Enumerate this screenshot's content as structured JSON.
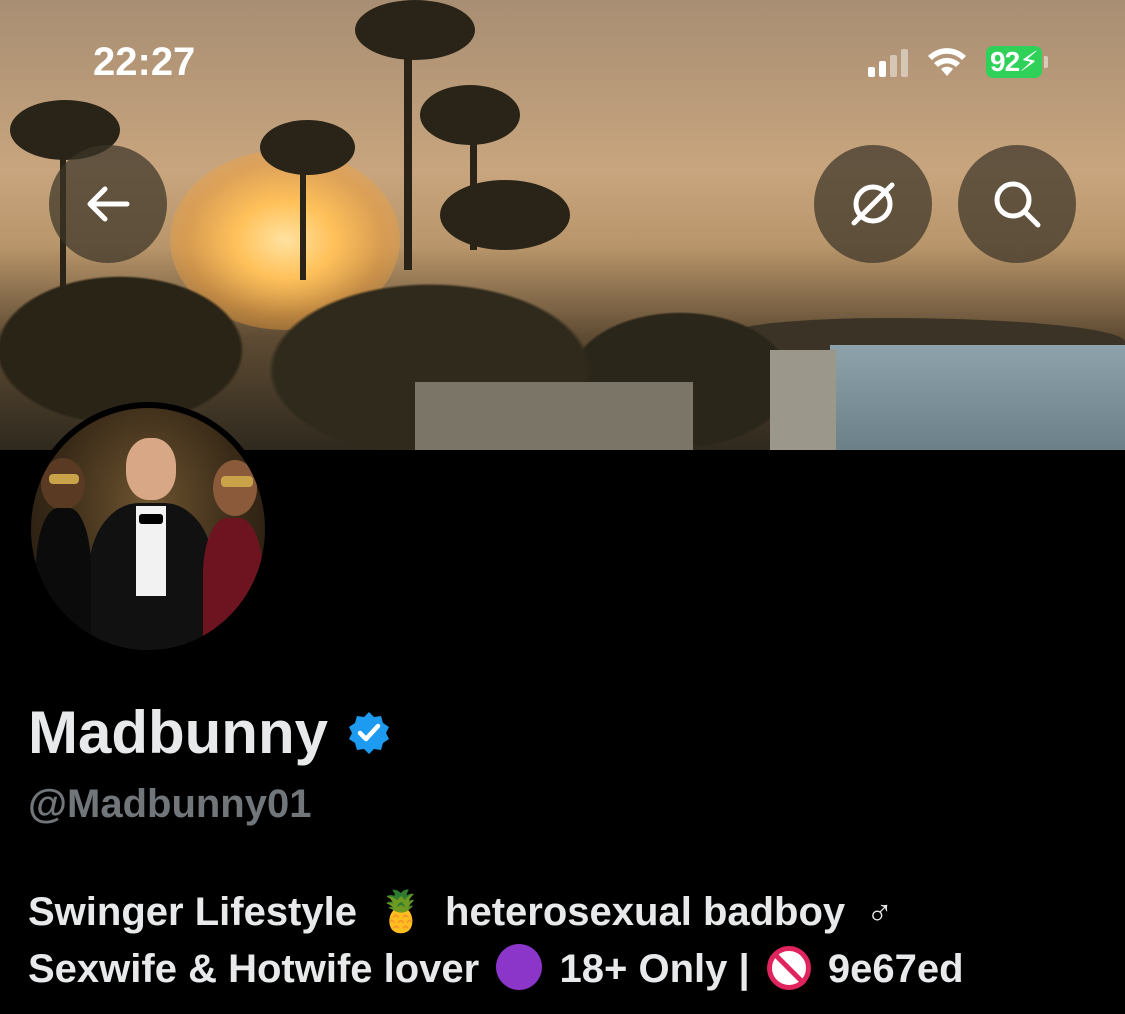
{
  "status_bar": {
    "time": "22:27",
    "battery": "92",
    "icons": [
      "cellular-signal-icon",
      "wifi-icon",
      "battery-charging-icon"
    ]
  },
  "header": {
    "back_icon": "arrow-left-icon",
    "grok_icon": "grok-icon",
    "search_icon": "search-icon"
  },
  "profile": {
    "display_name": "Madbunny",
    "verified": true,
    "verified_color": "#1d9bf0",
    "handle": "@Madbunny01",
    "bio_line1_a": "Swinger Lifestyle",
    "bio_line1_emoji1": "🍍",
    "bio_line1_b": "heterosexual badboy",
    "bio_line1_symbol": "♂",
    "bio_line2_a": "Sexwife & Hotwife lover",
    "bio_line2_b": "18+ Only |",
    "bio_line2_c": "9e67ed"
  },
  "colors": {
    "background": "#000000",
    "primary_text": "#e7e9ea",
    "secondary_text": "#71767b",
    "battery": "#30d158"
  }
}
